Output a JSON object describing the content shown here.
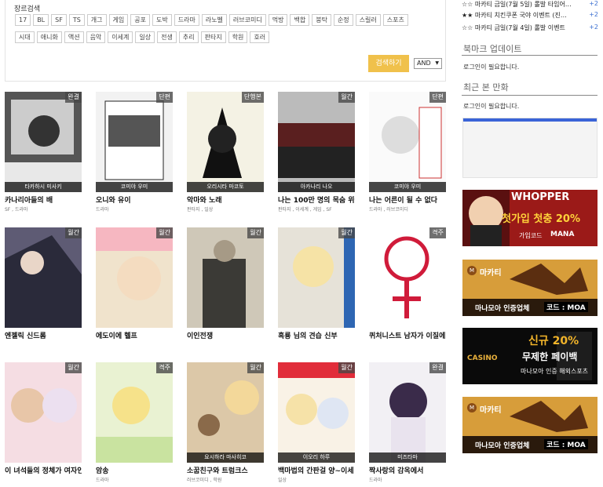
{
  "genre_search": {
    "title": "장르검색",
    "row1": [
      "17",
      "BL",
      "SF",
      "TS",
      "개그",
      "게임",
      "공포",
      "도박",
      "드라마",
      "라노벨",
      "러브코미디",
      "먹방",
      "백합",
      "붕탁",
      "순정",
      "스릴러",
      "스포츠"
    ],
    "row2": [
      "시대",
      "애니화",
      "액션",
      "음악",
      "이세계",
      "일상",
      "전생",
      "추리",
      "판타지",
      "학원",
      "호러"
    ],
    "search_button": "검색하기",
    "operator": "AND"
  },
  "comics": [
    {
      "badge": "완결",
      "author": "타카하시 미사키",
      "title": "카나리아들의 배",
      "genres": "SF , 드라마"
    },
    {
      "badge": "단편",
      "author": "코미야 우미",
      "title": "오니와 유이",
      "genres": "드라마"
    },
    {
      "badge": "단행본",
      "author": "오리시타 마코토",
      "title": "악마와 노래",
      "genres": "판타지 , 일상"
    },
    {
      "badge": "월간",
      "author": "아카나리 나오",
      "title": "나는 100만 명의 목숨 위에",
      "genres": "판타지 , 이세계 , 게임 , SF"
    },
    {
      "badge": "단편",
      "author": "코미야 우미",
      "title": "나는 어른이 될 수 없다",
      "genres": "드라마 , 러브코미디"
    },
    {
      "badge": "월간",
      "author": "",
      "title": "엔젤릭 신드롬",
      "genres": ""
    },
    {
      "badge": "월간",
      "author": "",
      "title": "에도이에 헬프",
      "genres": ""
    },
    {
      "badge": "월간",
      "author": "",
      "title": "이인전쟁",
      "genres": ""
    },
    {
      "badge": "월간",
      "author": "",
      "title": "흑룡 님의 견습 신부",
      "genres": ""
    },
    {
      "badge": "격주",
      "author": "",
      "title": "퀴처니스트 남자가 이질에",
      "genres": ""
    },
    {
      "badge": "월간",
      "author": "",
      "title": "이 녀석들의 정체가 여자인",
      "genres": ""
    },
    {
      "badge": "격주",
      "author": "",
      "title": "암송",
      "genres": "드라마"
    },
    {
      "badge": "월간",
      "author": "요시하라 마사히코",
      "title": "소꿉친구와 트럼크스",
      "genres": "러브코미디 , 학원"
    },
    {
      "badge": "월간",
      "author": "이오리 하루",
      "title": "백마법의 간판걸 양~이세",
      "genres": "일상"
    },
    {
      "badge": "완결",
      "author": "미즈타마",
      "title": "짝사랑의 감옥에서",
      "genres": "드라마"
    }
  ],
  "sidebar": {
    "events": [
      {
        "stars": "☆☆",
        "text": "마카티 금일(7월 5일) 롤발 타임어…",
        "plus": "+2"
      },
      {
        "stars": "★★",
        "text": "마카티 치킨쿠폰 국야 이벤트 (진…",
        "plus": "+2"
      },
      {
        "stars": "☆☆",
        "text": "마카티 금일(7월 4일) 롤발 이벤트",
        "plus": "+2"
      }
    ],
    "bookmark_title": "북마크 업데이트",
    "bookmark_text": "로그인이 필요합니다.",
    "recent_title": "최근 본 만화",
    "recent_text": "로그인이 필요합니다.",
    "ads": [
      {
        "brand": "WHOPPER",
        "headline": "첫가입 첫충 20%",
        "code": "가입코드",
        "code_value": "MANA"
      },
      {
        "brand": "마카티",
        "headline": "마나모아 인증업체",
        "code": "코드 : MOA"
      },
      {
        "brand": "CASINO",
        "headline": "신규 20%",
        "sub": "무제한 페이백",
        "foot": "마나모아 인증 해외스포츠"
      },
      {
        "brand": "마카티",
        "headline": "마나모아 인증업체",
        "code": "코드 : MOA"
      }
    ]
  }
}
